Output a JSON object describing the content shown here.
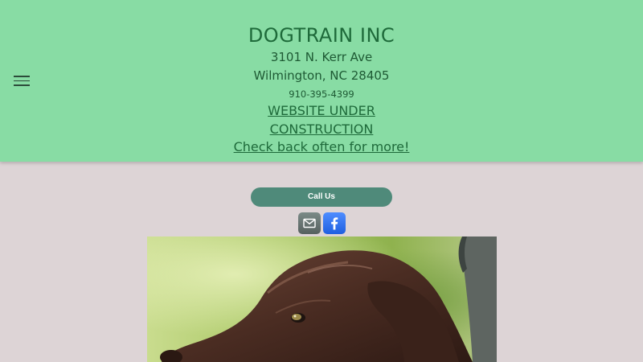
{
  "header": {
    "title": "DOGTRAIN INC",
    "address_line1": "3101 N. Kerr Ave",
    "address_line2": "Wilmington, NC 28405",
    "phone": "910-395-4399",
    "notice_line1": "WEBSITE UNDER",
    "notice_line2": "CONSTRUCTION",
    "notice_line3": "Check back often for more!",
    "menu_icon": "hamburger-menu-icon"
  },
  "actions": {
    "call_label": "Call Us"
  },
  "social": {
    "email_icon": "envelope-icon",
    "facebook_icon": "facebook-icon"
  },
  "colors": {
    "header_bg": "#88dca4",
    "page_bg": "#ddd4d6",
    "button_bg": "#4f8a7a",
    "facebook_blue": "#1f5fe0"
  }
}
